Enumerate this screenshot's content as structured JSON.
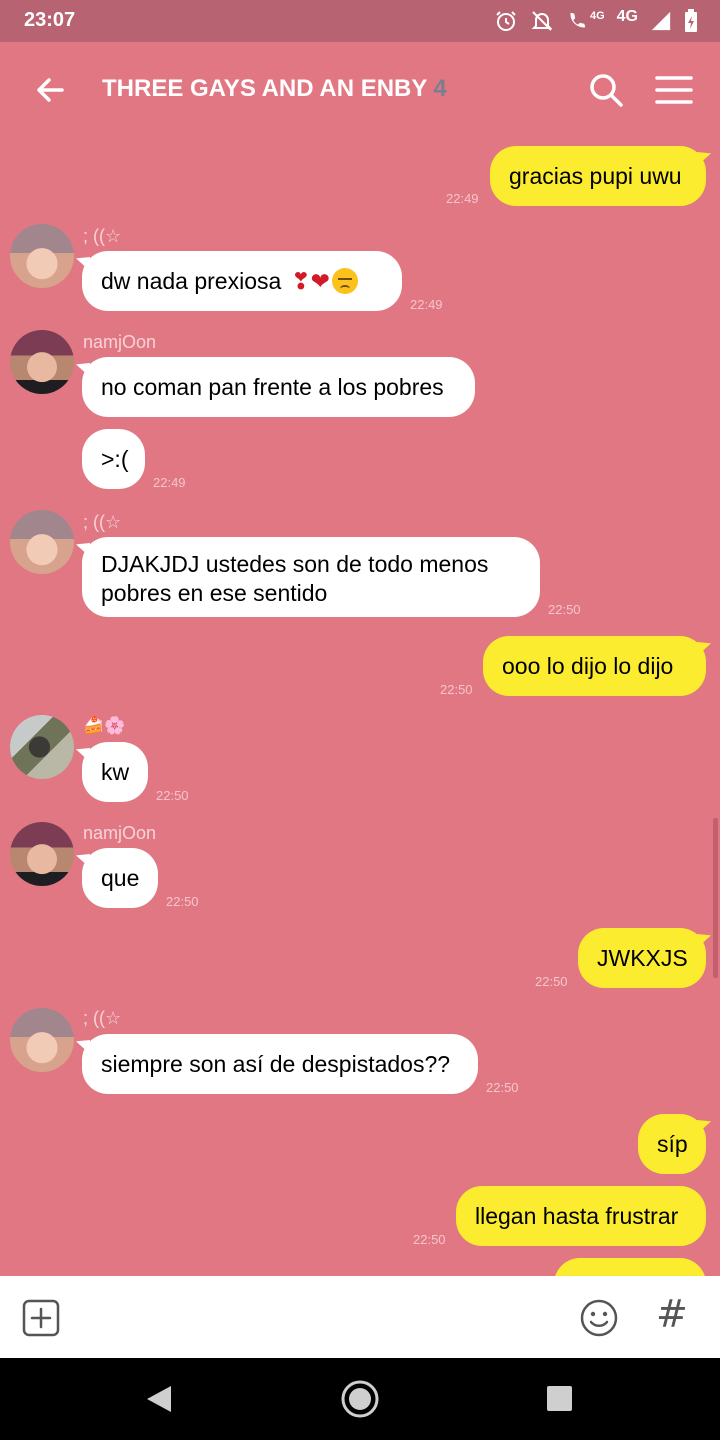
{
  "status_bar": {
    "time": "23:07",
    "network": "4G",
    "network_small": "4G"
  },
  "header": {
    "title": "THREE GAYS AND AN ENBY",
    "member_count": "4"
  },
  "messages": [
    {
      "text": "gracias pupi uwu",
      "time": "22:49"
    },
    {
      "sender": "; ((☆",
      "text": "dw nada prexiosa",
      "emoji": "❣❤",
      "time": "22:49"
    },
    {
      "sender": "namjOon",
      "text": "no coman pan frente a los pobres"
    },
    {
      "text": ">:(",
      "time": "22:49"
    },
    {
      "sender": "; ((☆",
      "text": "DJAKJDJ ustedes son de todo menos pobres en ese sentido",
      "time": "22:50"
    },
    {
      "text": "ooo lo dijo lo dijo",
      "time": "22:50"
    },
    {
      "sender": "🍰🌸",
      "text": "kw",
      "time": "22:50"
    },
    {
      "sender": "namjOon",
      "text": "que",
      "time": "22:50"
    },
    {
      "text": "JWKXJS",
      "time": "22:50"
    },
    {
      "sender": "; ((☆",
      "text": "siempre son así de despistados??",
      "time": "22:50"
    },
    {
      "text": "síp"
    },
    {
      "text": "llegan hasta frustrar",
      "time": "22:50"
    }
  ],
  "input_bar": {
    "hashtag": "#"
  },
  "colors": {
    "background": "#e27784",
    "status_bar": "#b86371",
    "outgoing_bubble": "#fcec30",
    "incoming_bubble": "#ffffff",
    "member_count": "#7a7e90"
  }
}
